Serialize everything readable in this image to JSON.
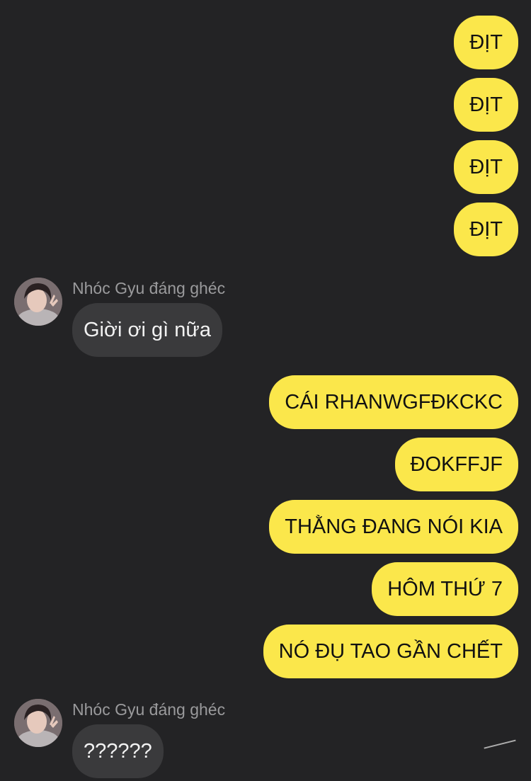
{
  "sender_name": "Nhóc Gyu đáng ghéc",
  "colors": {
    "background": "#232325",
    "outgoing_bubble": "#FBE74B",
    "incoming_bubble": "#3A3A3C",
    "sender_name_text": "#9A9A9C"
  },
  "messages": [
    {
      "direction": "outgoing",
      "text": "ĐỊT"
    },
    {
      "direction": "outgoing",
      "text": "ĐỊT"
    },
    {
      "direction": "outgoing",
      "text": "ĐỊT"
    },
    {
      "direction": "outgoing",
      "text": "ĐỊT"
    },
    {
      "direction": "incoming",
      "sender": "Nhóc Gyu đáng ghéc",
      "text": "Giời ơi gì nữa"
    },
    {
      "direction": "outgoing",
      "text": "CÁI RHANWGFĐKCKC"
    },
    {
      "direction": "outgoing",
      "text": "ĐOKFFJF"
    },
    {
      "direction": "outgoing",
      "text": "THẰNG ĐANG NÓI KIA"
    },
    {
      "direction": "outgoing",
      "text": "HÔM THỨ 7"
    },
    {
      "direction": "outgoing",
      "text": "NÓ ĐỤ TAO GẦN CHẾT"
    },
    {
      "direction": "incoming",
      "sender": "Nhóc Gyu đáng ghéc",
      "text": "??????"
    }
  ]
}
